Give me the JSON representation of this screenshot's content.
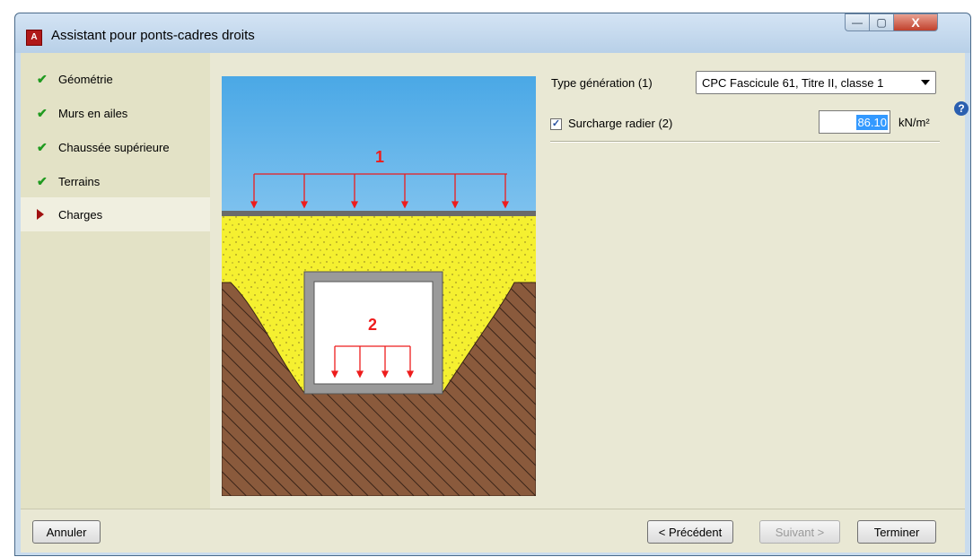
{
  "window": {
    "title": "Assistant pour ponts-cadres droits",
    "minimize_symbol": "—",
    "maximize_symbol": "▢",
    "close_symbol": "X"
  },
  "sidebar": {
    "items": [
      {
        "label": "Géométrie",
        "state": "done"
      },
      {
        "label": "Murs en ailes",
        "state": "done"
      },
      {
        "label": "Chaussée supérieure",
        "state": "done"
      },
      {
        "label": "Terrains",
        "state": "done"
      },
      {
        "label": "Charges",
        "state": "current"
      }
    ]
  },
  "illustration": {
    "label_1": "1",
    "label_2": "2",
    "colors": {
      "sky": "#7ec8f2",
      "soil": "#f5f030",
      "ground": "#8a5a3c",
      "load": "#ee1c1c",
      "frame": "#9a9a9a"
    }
  },
  "form": {
    "type_label": "Type génération (1)",
    "type_value": "CPC Fascicule 61, Titre II, classe 1",
    "surcharge_checked": true,
    "surcharge_label": "Surcharge radier (2)",
    "surcharge_value": "86.10",
    "surcharge_unit": "kN/m²"
  },
  "help_icon": "?",
  "footer": {
    "cancel": "Annuler",
    "previous": "< Précédent",
    "next": "Suivant >",
    "finish": "Terminer"
  }
}
